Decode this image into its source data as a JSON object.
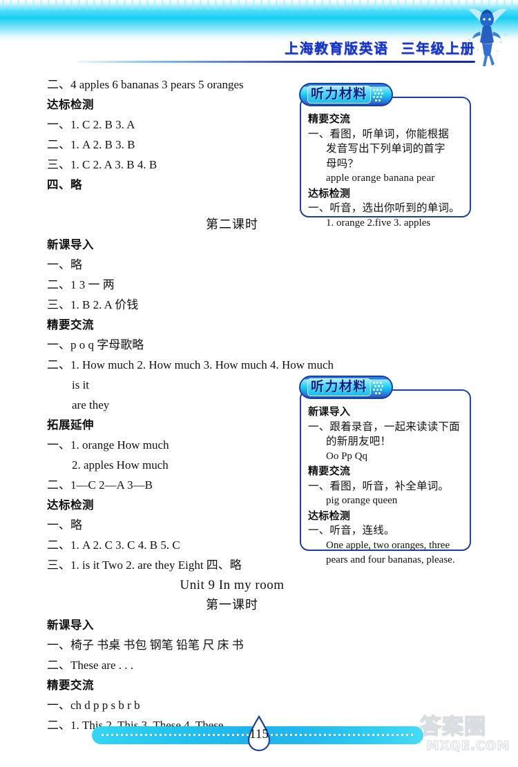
{
  "header": {
    "title_main": "上海教育版英语",
    "title_grade": "三年级上册",
    "fairy_icon": "fairy-icon"
  },
  "content_lines": [
    {
      "id": "l1",
      "type": "answer",
      "text": "二、4 apples   6 bananas   3 pears   5 oranges"
    },
    {
      "id": "l2",
      "type": "cn-head",
      "text": "达标检测"
    },
    {
      "id": "l3",
      "type": "answer",
      "text": "一、1. C  2. B  3. A"
    },
    {
      "id": "l4",
      "type": "answer",
      "text": "二、1. A  2. B  3. B"
    },
    {
      "id": "l5",
      "type": "answer",
      "text": "三、1. C  2. A  3. B  4. B"
    },
    {
      "id": "l6",
      "type": "cn-head",
      "text": "四、略"
    },
    {
      "id": "l7",
      "type": "blank",
      "text": ""
    },
    {
      "id": "l8",
      "type": "centerish",
      "text": "第二课时"
    },
    {
      "id": "l9",
      "type": "cn-head",
      "text": "新课导入"
    },
    {
      "id": "l10",
      "type": "answer",
      "text": "一、略"
    },
    {
      "id": "l11",
      "type": "answer",
      "text": "二、1  3   一   两"
    },
    {
      "id": "l12",
      "type": "answer",
      "text": "三、1. B  2. A   价钱"
    },
    {
      "id": "l13",
      "type": "cn-head",
      "text": "精要交流"
    },
    {
      "id": "l14",
      "type": "answer",
      "text": "一、p  o  q   字母歌略"
    },
    {
      "id": "l15",
      "type": "answer",
      "text": "二、1. How much  2. How much  3. How much  4. How much"
    },
    {
      "id": "l16",
      "type": "indent",
      "text": "is it"
    },
    {
      "id": "l17",
      "type": "indent",
      "text": "are they"
    },
    {
      "id": "l18",
      "type": "cn-head",
      "text": "拓展延伸"
    },
    {
      "id": "l19",
      "type": "answer",
      "text": "一、1. orange   How much"
    },
    {
      "id": "l20",
      "type": "indent",
      "text": "2. apples   How much"
    },
    {
      "id": "l21",
      "type": "answer",
      "text": "二、1—C   2—A   3—B"
    },
    {
      "id": "l22",
      "type": "cn-head",
      "text": "达标检测"
    },
    {
      "id": "l23",
      "type": "answer",
      "text": "一、略"
    },
    {
      "id": "l24",
      "type": "answer",
      "text": "二、1. A  2. C  3. C  4. B  5. C"
    },
    {
      "id": "l25",
      "type": "answer",
      "text": "三、1. is it  Two  2. are they  Eight   四、略"
    },
    {
      "id": "l26",
      "type": "unit-title",
      "text": "Unit 9 In my room"
    },
    {
      "id": "l27",
      "type": "centerish",
      "text": "第一课时"
    },
    {
      "id": "l28",
      "type": "cn-head",
      "text": "新课导入"
    },
    {
      "id": "l29",
      "type": "answer",
      "text": "一、椅子   书桌   书包   钢笔   铅笔   尺   床   书"
    },
    {
      "id": "l30",
      "type": "answer",
      "text": "二、These are . . ."
    },
    {
      "id": "l31",
      "type": "cn-head",
      "text": "精要交流"
    },
    {
      "id": "l32",
      "type": "answer",
      "text": "一、ch  d  p  p  s  b  r  b"
    },
    {
      "id": "l33",
      "type": "answer",
      "text": "二、1. This  2. This  3. These  4. These"
    }
  ],
  "listening_boxes": [
    {
      "id": "box1",
      "tab_label": "听力材料",
      "rows": [
        {
          "style": "head",
          "text": "精要交流"
        },
        {
          "style": "cnrow",
          "text": "一、看图，听单词，你能根据"
        },
        {
          "style": "cnrow hang",
          "text": "发音写出下列单词的首字"
        },
        {
          "style": "cnrow hang",
          "text": "母吗？"
        },
        {
          "style": "enrow wide",
          "text": "apple  orange  banana  pear"
        },
        {
          "style": "head",
          "text": "达标检测"
        },
        {
          "style": "cnrow",
          "text": "一、听音，选出你听到的单词。"
        },
        {
          "style": "enrow",
          "text": "1. orange  2.five  3. apples"
        }
      ]
    },
    {
      "id": "box2",
      "tab_label": "听力材料",
      "rows": [
        {
          "style": "head",
          "text": "新课导入"
        },
        {
          "style": "cnrow",
          "text": "一、跟着录音，一起来读读下面"
        },
        {
          "style": "cnrow hang",
          "text": "的新朋友吧！"
        },
        {
          "style": "enrow",
          "text": "Oo  Pp  Qq"
        },
        {
          "style": "head",
          "text": "精要交流"
        },
        {
          "style": "cnrow",
          "text": "一、看图，听音，补全单词。"
        },
        {
          "style": "enrow",
          "text": "pig  orange  queen"
        },
        {
          "style": "head",
          "text": "达标检测"
        },
        {
          "style": "cnrow",
          "text": "一、听音，连线。"
        },
        {
          "style": "enrow",
          "text": "One apple, two oranges, three"
        },
        {
          "style": "enrow",
          "text": "pears and four bananas, please."
        }
      ]
    }
  ],
  "footer": {
    "page_number": "115",
    "watermark_cn": "答案圈",
    "watermark_en": "MXQE.COM"
  },
  "colors": {
    "header_cyan": "#1fcdf2",
    "title_blue": "#1330c8",
    "box_border": "#1a3fa8",
    "tab_gradient_light": "#9ce8fb",
    "tab_gradient_dark": "#27509f",
    "footer_bar": "#24c6ef",
    "watermark_gray": "#d9dde2"
  }
}
